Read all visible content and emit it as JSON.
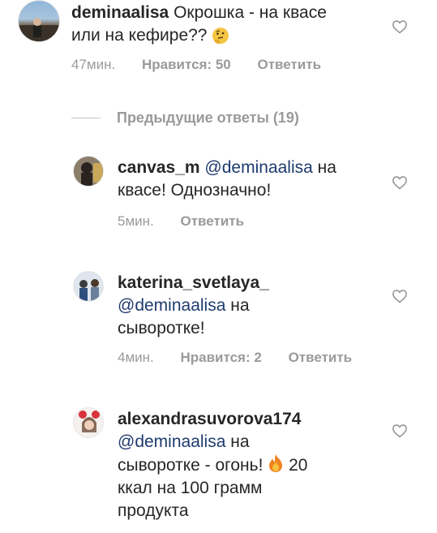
{
  "comments": [
    {
      "username": "deminaalisa",
      "text": "Окрошка - на квасе или на кефире??",
      "emoji": "thinking-face-emoji",
      "time": "47мин.",
      "likes": "Нравится: 50",
      "reply": "Ответить"
    }
  ],
  "replies_toggle": {
    "label": "Предыдущие ответы (19)"
  },
  "replies": [
    {
      "username": "canvas_m",
      "mention": "@deminaalisa",
      "text_line1_tail": "на",
      "text_line2": "квасе! Однозначно!",
      "time": "5мин.",
      "reply": "Ответить"
    },
    {
      "username": "katerina_svetlaya_",
      "mention": "@deminaalisa",
      "text_line2_tail": "на",
      "text_line3": "сыворотке!",
      "time": "4мин.",
      "likes": "Нравится: 2",
      "reply": "Ответить"
    },
    {
      "username": "alexandrasuvorova174",
      "mention": "@deminaalisa",
      "text_line2_tail": "на",
      "text_line3_a": "сыворотке - огонь!",
      "emoji": "fire-emoji",
      "text_line3_b": "20",
      "text_line4": "ккал на 100 грамм",
      "text_line5": "продукта"
    }
  ],
  "icons": {
    "like": "heart-outline-icon",
    "avatar_main": "avatar-deminaalisa",
    "avatar_1": "avatar-canvas_m",
    "avatar_2": "avatar-katerina_svetlaya_",
    "avatar_3": "avatar-alexandrasuvorova174"
  },
  "colors": {
    "text": "#262626",
    "muted": "#9a9a9a",
    "mention": "#1e3a6e"
  }
}
